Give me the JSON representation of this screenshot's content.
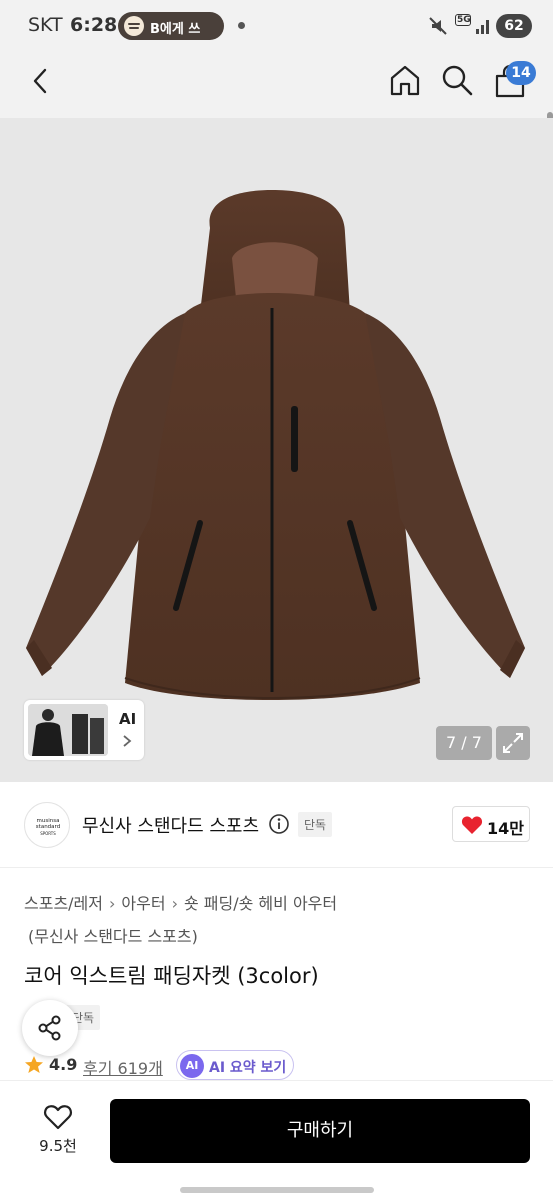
{
  "status_bar": {
    "carrier": "SKT",
    "time": "6:28",
    "media_label": "B에게 쓰",
    "network": "5G",
    "battery": "62"
  },
  "nav": {
    "cart_count": "14"
  },
  "gallery": {
    "thumb_label": "AI",
    "pager": "7 / 7",
    "jacket_color": "#5e3b2b"
  },
  "brand": {
    "logo_line1": "musinsa",
    "logo_line2": "standard",
    "logo_line3": "SPORTS",
    "name": "무신사 스탠다드 스포츠",
    "exclusive_tag": "단독",
    "likes": "14만"
  },
  "product": {
    "breadcrumb": [
      "스포츠/레저",
      "아우터",
      "숏 패딩/숏 헤비 아우터"
    ],
    "breadcrumb_sub": "(무신사 스탠다드 스포츠)",
    "title": "코어 익스트림 패딩자켓 (3color)",
    "tag": "단독",
    "rating": "4.9",
    "reviews": "후기 619개",
    "ai_badge": "AI",
    "ai_summary": "AI 요약 보기"
  },
  "bottom": {
    "wish_count": "9.5천",
    "buy_label": "구매하기"
  },
  "colors": {
    "accent_blue": "#3a7bd5",
    "heart_red": "#e8232f",
    "star": "#f5a623",
    "ai_purple": "#7b68ee"
  }
}
